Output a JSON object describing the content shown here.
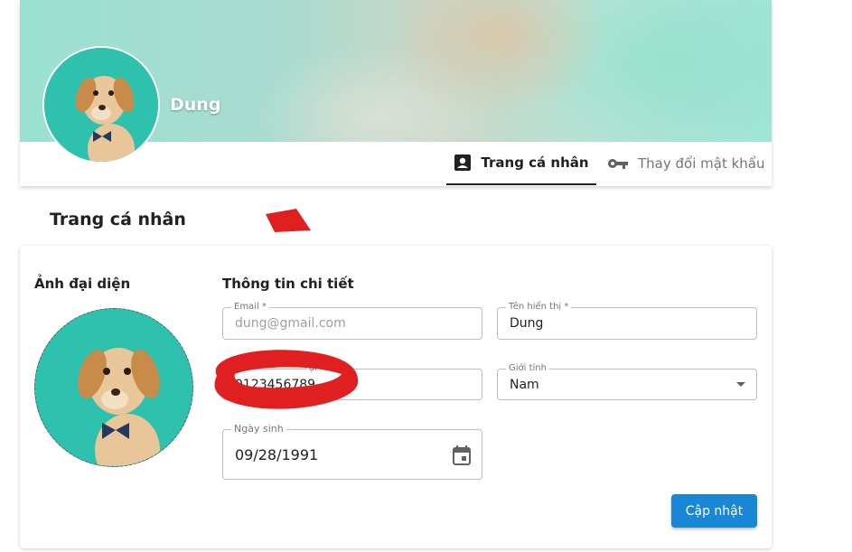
{
  "header": {
    "username": "Dung",
    "tabs": [
      {
        "label": "Trang cá nhân",
        "icon": "account-box-icon",
        "active": true
      },
      {
        "label": "Thay đổi mật khẩu",
        "icon": "key-icon",
        "active": false
      }
    ]
  },
  "page": {
    "title": "Trang cá nhân"
  },
  "avatar_section": {
    "heading": "Ảnh đại diện"
  },
  "details": {
    "heading": "Thông tin chi tiết",
    "email": {
      "label": "Email *",
      "value": "dung@gmail.com"
    },
    "display_name": {
      "label": "Tên hiển thị *",
      "value": "Dung"
    },
    "phone": {
      "label": "ại *",
      "value": "0123456789"
    },
    "gender": {
      "label": "Giới tính",
      "value": "Nam"
    },
    "birthday": {
      "label": "Ngày sinh",
      "value": "09/28/1991"
    }
  },
  "actions": {
    "update_label": "Cập nhật"
  },
  "colors": {
    "primary_button": "#1a86d6",
    "redaction": "#e02020",
    "cover_teal": "#9be0d1"
  }
}
